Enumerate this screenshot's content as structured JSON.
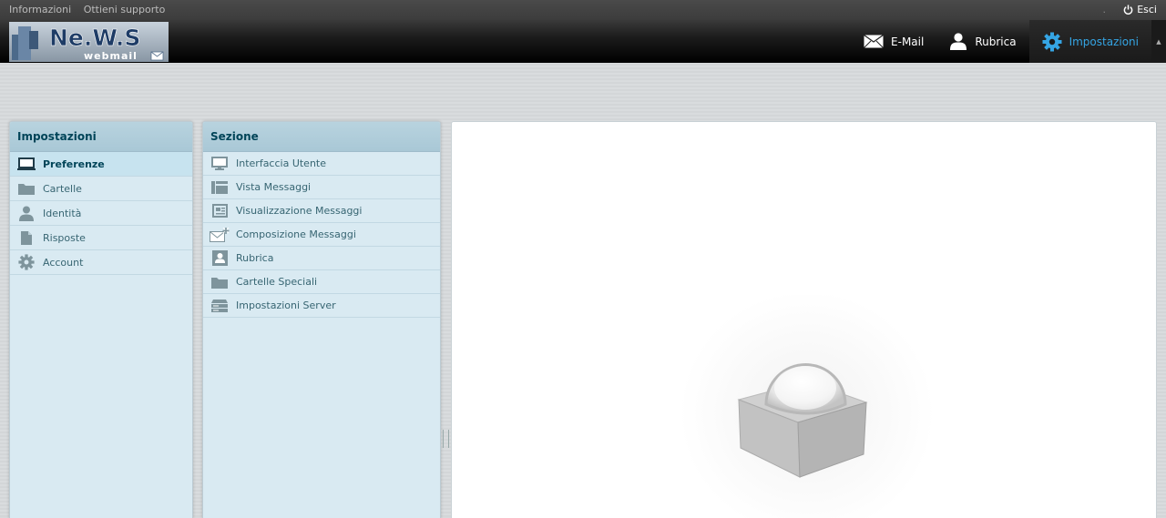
{
  "topline": {
    "links": [
      "Informazioni",
      "Ottieni supporto"
    ],
    "logout_label": "Esci"
  },
  "logo": {
    "main": "Ne.W.S",
    "sub": "webmail"
  },
  "nav": {
    "mail_label": "E-Mail",
    "contacts_label": "Rubrica",
    "settings_label": "Impostazioni",
    "active": "settings"
  },
  "prefs": {
    "title": "Impostazioni",
    "items": [
      {
        "label": "Preferenze",
        "icon": "monitor-icon",
        "selected": true
      },
      {
        "label": "Cartelle",
        "icon": "folder-icon"
      },
      {
        "label": "Identità",
        "icon": "person-icon"
      },
      {
        "label": "Risposte",
        "icon": "document-icon"
      },
      {
        "label": "Account",
        "icon": "gear-icon"
      }
    ]
  },
  "sections": {
    "title": "Sezione",
    "items": [
      {
        "label": "Interfaccia Utente",
        "icon": "monitor-icon"
      },
      {
        "label": "Vista Messaggi",
        "icon": "layout-icon"
      },
      {
        "label": "Visualizzazione Messaggi",
        "icon": "message-view-icon"
      },
      {
        "label": "Composizione Messaggi",
        "icon": "compose-icon"
      },
      {
        "label": "Rubrica",
        "icon": "contact-card-icon"
      },
      {
        "label": "Cartelle Speciali",
        "icon": "folder-icon"
      },
      {
        "label": "Impostazioni Server",
        "icon": "server-icon"
      }
    ]
  },
  "colors": {
    "accent": "#35a5e4",
    "panel": "#d9eaf2",
    "header_text": "#004458"
  }
}
